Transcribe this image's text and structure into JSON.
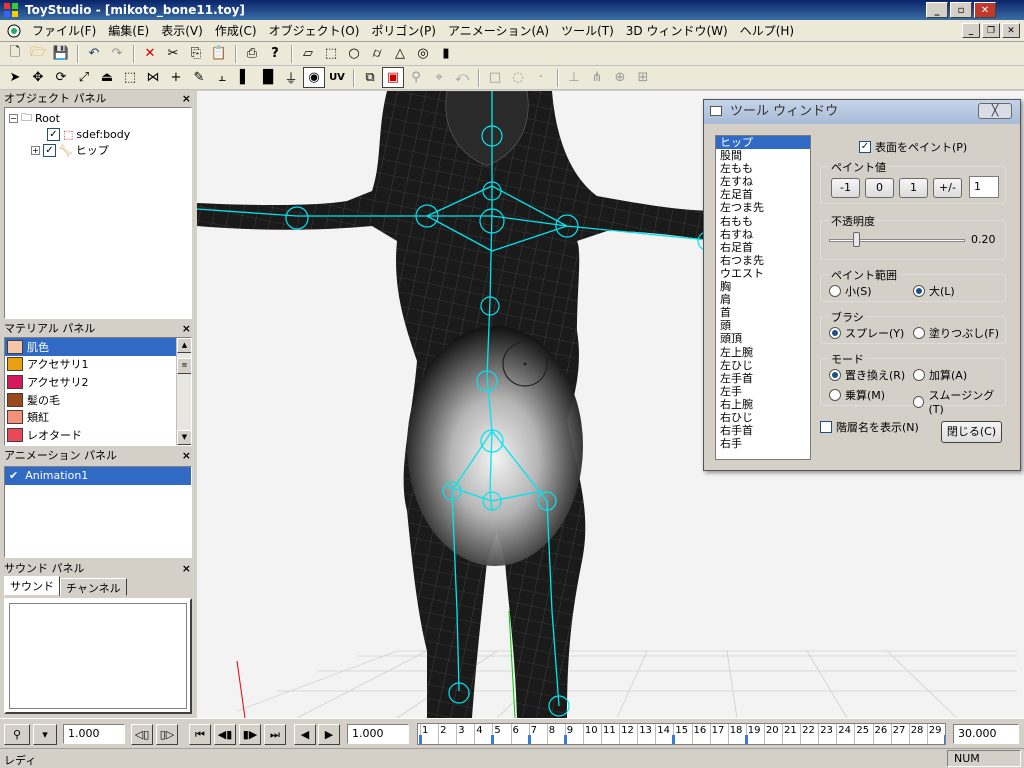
{
  "window": {
    "title": "ToyStudio - [mikoto_bone11.toy]"
  },
  "menu": [
    "ファイル(F)",
    "編集(E)",
    "表示(V)",
    "作成(C)",
    "オブジェクト(O)",
    "ポリゴン(P)",
    "アニメーション(A)",
    "ツール(T)",
    "3D ウィンドウ(W)",
    "ヘルプ(H)"
  ],
  "toolbar2": {
    "uv_label": "UV"
  },
  "object_panel": {
    "title": "オブジェクト パネル",
    "root": "Root",
    "items": [
      "sdef:body",
      "ヒップ"
    ]
  },
  "material_panel": {
    "title": "マテリアル パネル",
    "items": [
      {
        "name": "肌色",
        "color": "#f4c4a8",
        "selected": true
      },
      {
        "name": "アクセサリ1",
        "color": "#e8a010",
        "selected": false
      },
      {
        "name": "アクセサリ2",
        "color": "#d8185c",
        "selected": false
      },
      {
        "name": "髪の毛",
        "color": "#9a4a1c",
        "selected": false
      },
      {
        "name": "頬紅",
        "color": "#f4907a",
        "selected": false
      },
      {
        "name": "レオタード",
        "color": "#e84858",
        "selected": false
      }
    ]
  },
  "animation_panel": {
    "title": "アニメーション パネル",
    "items": [
      "Animation1"
    ]
  },
  "sound_panel": {
    "title": "サウンド パネル",
    "tabs": [
      "サウンド",
      "チャンネル"
    ]
  },
  "tool_window": {
    "title": "ツール ウィンドウ",
    "close_x": "╳",
    "bones": [
      "ヒップ",
      "股間",
      "左もも",
      "左すね",
      "左足首",
      "左つま先",
      "右もも",
      "右すね",
      "右足首",
      "右つま先",
      "ウエスト",
      "胸",
      "肩",
      "首",
      "頭",
      "頭頂",
      "左上腕",
      "左ひじ",
      "左手首",
      "左手",
      "右上腕",
      "右ひじ",
      "右手首",
      "右手"
    ],
    "paint_surface_label": "表面をペイント(P)",
    "paint_value": {
      "label": "ペイント値",
      "buttons": [
        "-1",
        "0",
        "1",
        "+/-"
      ],
      "value": "1"
    },
    "opacity": {
      "label": "不透明度",
      "value": "0.20",
      "level": 0.2
    },
    "range": {
      "label": "ペイント範囲",
      "small": "小(S)",
      "large": "大(L)",
      "selected": "large"
    },
    "brush": {
      "label": "ブラシ",
      "spray": "スプレー(Y)",
      "fill": "塗りつぶし(F)",
      "selected": "spray"
    },
    "mode": {
      "label": "モード",
      "replace": "置き換え(R)",
      "add": "加算(A)",
      "multiply": "乗算(M)",
      "smooth": "スムージング(T)",
      "selected": "replace"
    },
    "show_hierarchy": "階層名を表示(N)",
    "close_button": "閉じる(C)"
  },
  "timeline": {
    "speed": "1.000",
    "current": "1.000",
    "end": "30.000",
    "frames": [
      "1",
      "2",
      "3",
      "4",
      "5",
      "6",
      "7",
      "8",
      "9",
      "10",
      "11",
      "12",
      "13",
      "14",
      "15",
      "16",
      "17",
      "18",
      "19",
      "20",
      "21",
      "22",
      "23",
      "24",
      "25",
      "26",
      "27",
      "28",
      "29"
    ],
    "keyframes": [
      1,
      5,
      7,
      9,
      15,
      19,
      30
    ]
  },
  "status": {
    "message": "レディ",
    "num": "NUM"
  },
  "colors": {
    "accent": "#316ac5",
    "bone": "#00e5ee",
    "title": "#0a246a"
  }
}
